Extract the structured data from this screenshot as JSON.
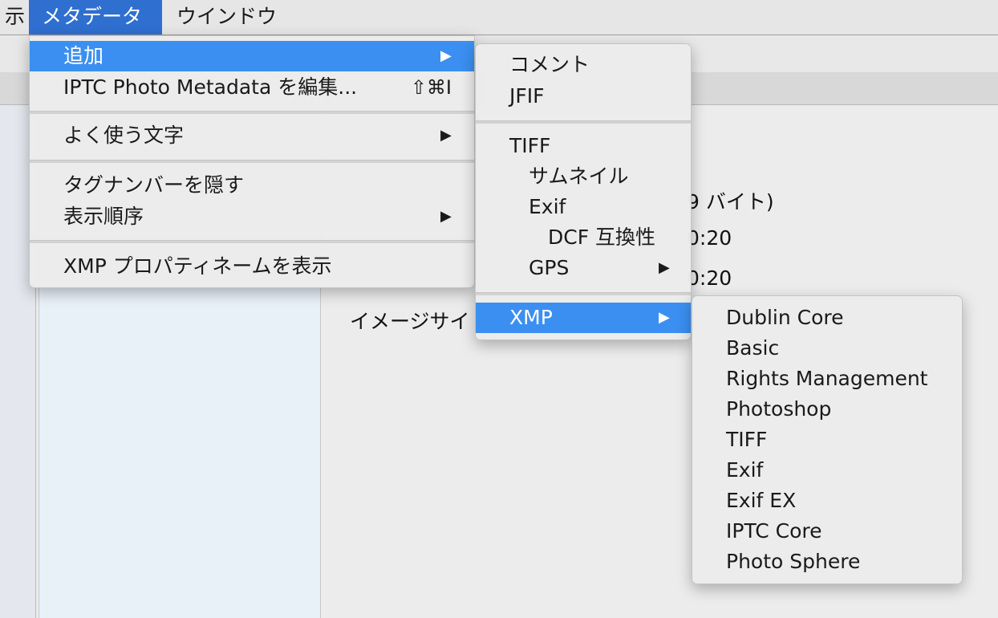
{
  "menubar": {
    "items": [
      {
        "label": "示"
      },
      {
        "label": "メタデータ"
      },
      {
        "label": "ウインドウ"
      }
    ]
  },
  "content": {
    "line1": "9 バイト)",
    "line2": "0:20",
    "line3": "0:20",
    "line4": "イメージサイ"
  },
  "metadata_menu": {
    "items": [
      {
        "label": "追加"
      },
      {
        "label": "IPTC Photo Metadata を編集...",
        "shortcut": "⇧⌘I"
      },
      {
        "label": "よく使う文字"
      },
      {
        "label": "タグナンバーを隠す"
      },
      {
        "label": "表示順序"
      },
      {
        "label": "XMP プロパティネームを表示"
      }
    ],
    "arrow": "▶"
  },
  "add_submenu": {
    "items": [
      {
        "label": "コメント"
      },
      {
        "label": "JFIF"
      },
      {
        "label": "TIFF"
      },
      {
        "label": "サムネイル"
      },
      {
        "label": "Exif"
      },
      {
        "label": "DCF 互換性"
      },
      {
        "label": "GPS"
      },
      {
        "label": "XMP"
      }
    ]
  },
  "xmp_submenu": {
    "items": [
      {
        "label": "Dublin Core"
      },
      {
        "label": "Basic"
      },
      {
        "label": "Rights Management"
      },
      {
        "label": "Photoshop"
      },
      {
        "label": "TIFF"
      },
      {
        "label": "Exif"
      },
      {
        "label": "Exif EX"
      },
      {
        "label": "IPTC Core"
      },
      {
        "label": "Photo Sphere"
      }
    ]
  },
  "colors": {
    "highlight": "#3b8ff0",
    "menubar_active": "#2f6fd0"
  }
}
